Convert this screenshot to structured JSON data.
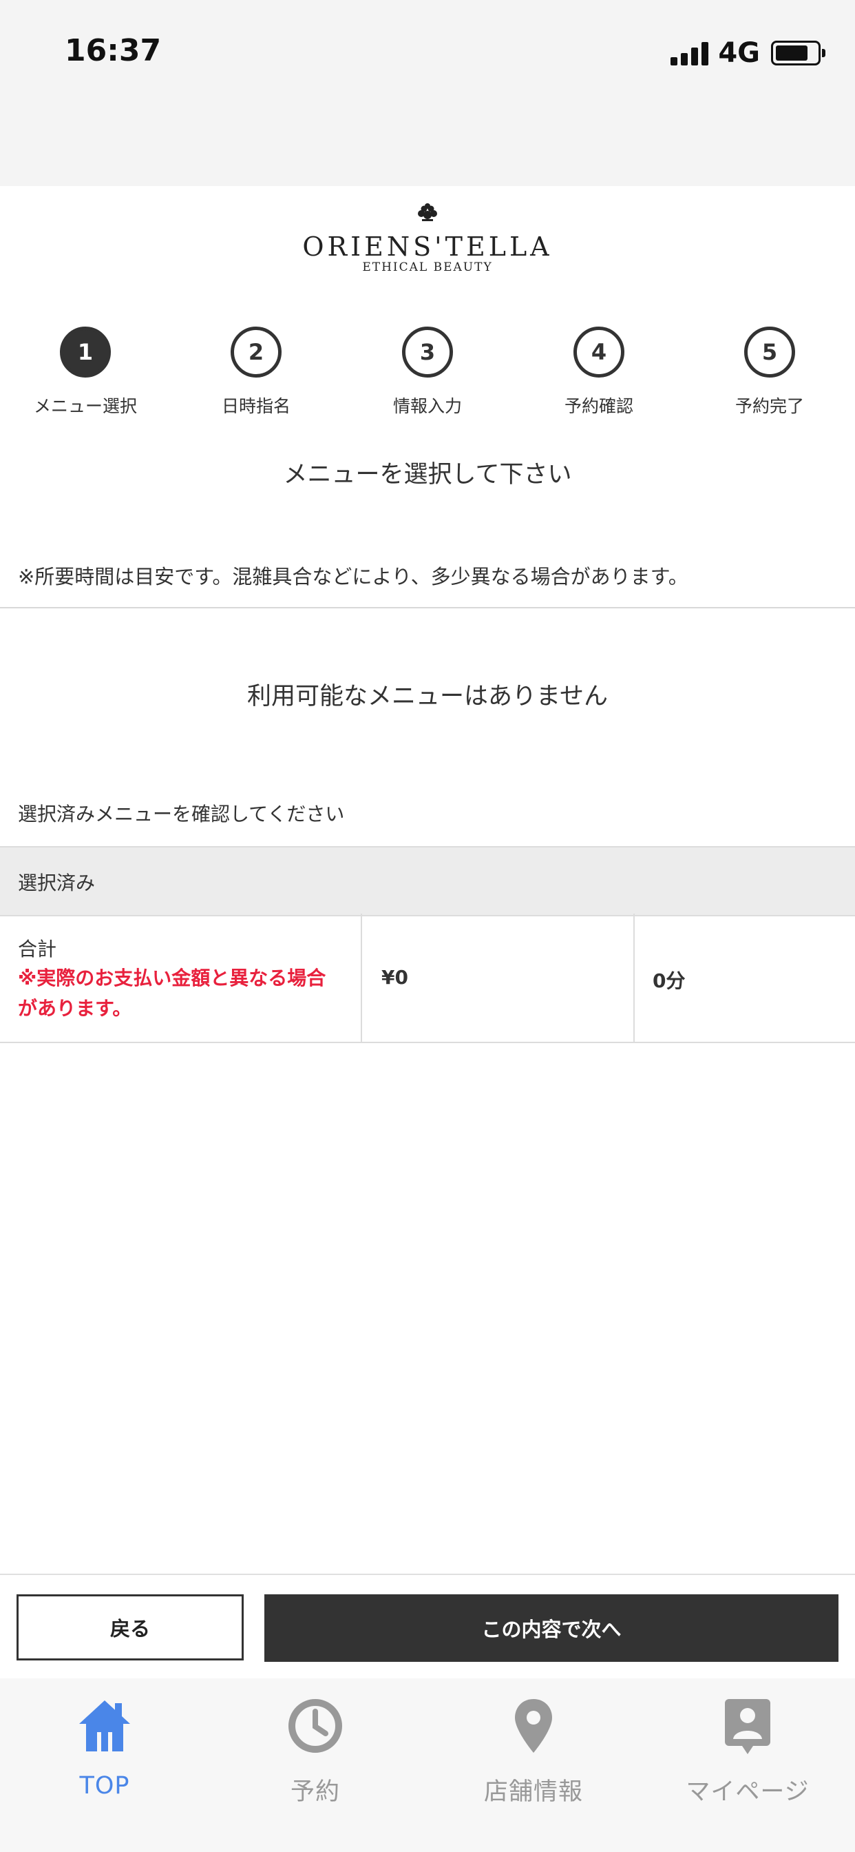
{
  "status_bar": {
    "time": "16:37",
    "network": "4G",
    "battery_level": 0.8
  },
  "brand": {
    "name": "ORIENS'TELLA",
    "tagline": "ETHICAL BEAUTY",
    "logo_icon": "flower-emblem-icon"
  },
  "steps": [
    {
      "number": "1",
      "label": "メニュー選択",
      "active": true
    },
    {
      "number": "2",
      "label": "日時指名",
      "active": false
    },
    {
      "number": "3",
      "label": "情報入力",
      "active": false
    },
    {
      "number": "4",
      "label": "予約確認",
      "active": false
    },
    {
      "number": "5",
      "label": "予約完了",
      "active": false
    }
  ],
  "main": {
    "title": "メニューを選択して下さい",
    "notice": "※所要時間は目安です。混雑具合などにより、多少異なる場合があります。",
    "empty_message": "利用可能なメニューはありません",
    "confirm_label": "選択済みメニューを確認してください"
  },
  "selected": {
    "header": "選択済み",
    "total_label": "合計",
    "total_warning": "※実際のお支払い金額と異なる場合があります。",
    "total_price": "¥0",
    "total_time": "0分"
  },
  "actions": {
    "back_label": "戻る",
    "next_label": "この内容で次へ"
  },
  "tabbar": {
    "active_color": "#4a86e8",
    "inactive_color": "#999999",
    "items": [
      {
        "label": "TOP",
        "icon": "home-icon",
        "active": true
      },
      {
        "label": "予約",
        "icon": "clock-icon",
        "active": false
      },
      {
        "label": "店舗情報",
        "icon": "map-pin-icon",
        "active": false
      },
      {
        "label": "マイページ",
        "icon": "user-card-icon",
        "active": false
      }
    ]
  },
  "colors": {
    "primary_dark": "#333333",
    "warning_red": "#e8213d",
    "header_gray": "#ececec"
  }
}
